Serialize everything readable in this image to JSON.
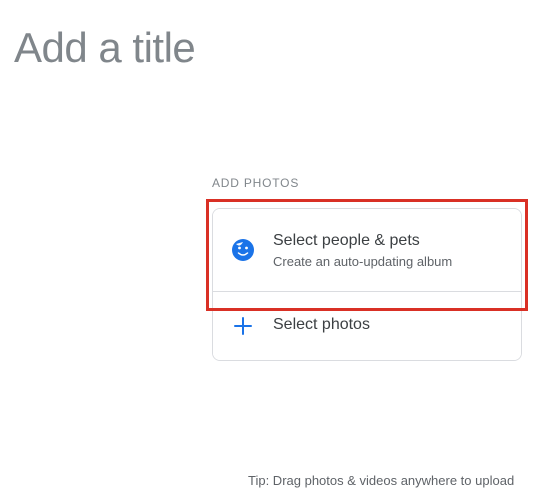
{
  "title_placeholder": "Add a title",
  "section_label": "ADD PHOTOS",
  "option_people": {
    "title": "Select people & pets",
    "subtitle": "Create an auto-updating album"
  },
  "option_photos": {
    "title": "Select photos"
  },
  "tip": "Tip: Drag photos & videos anywhere to upload"
}
